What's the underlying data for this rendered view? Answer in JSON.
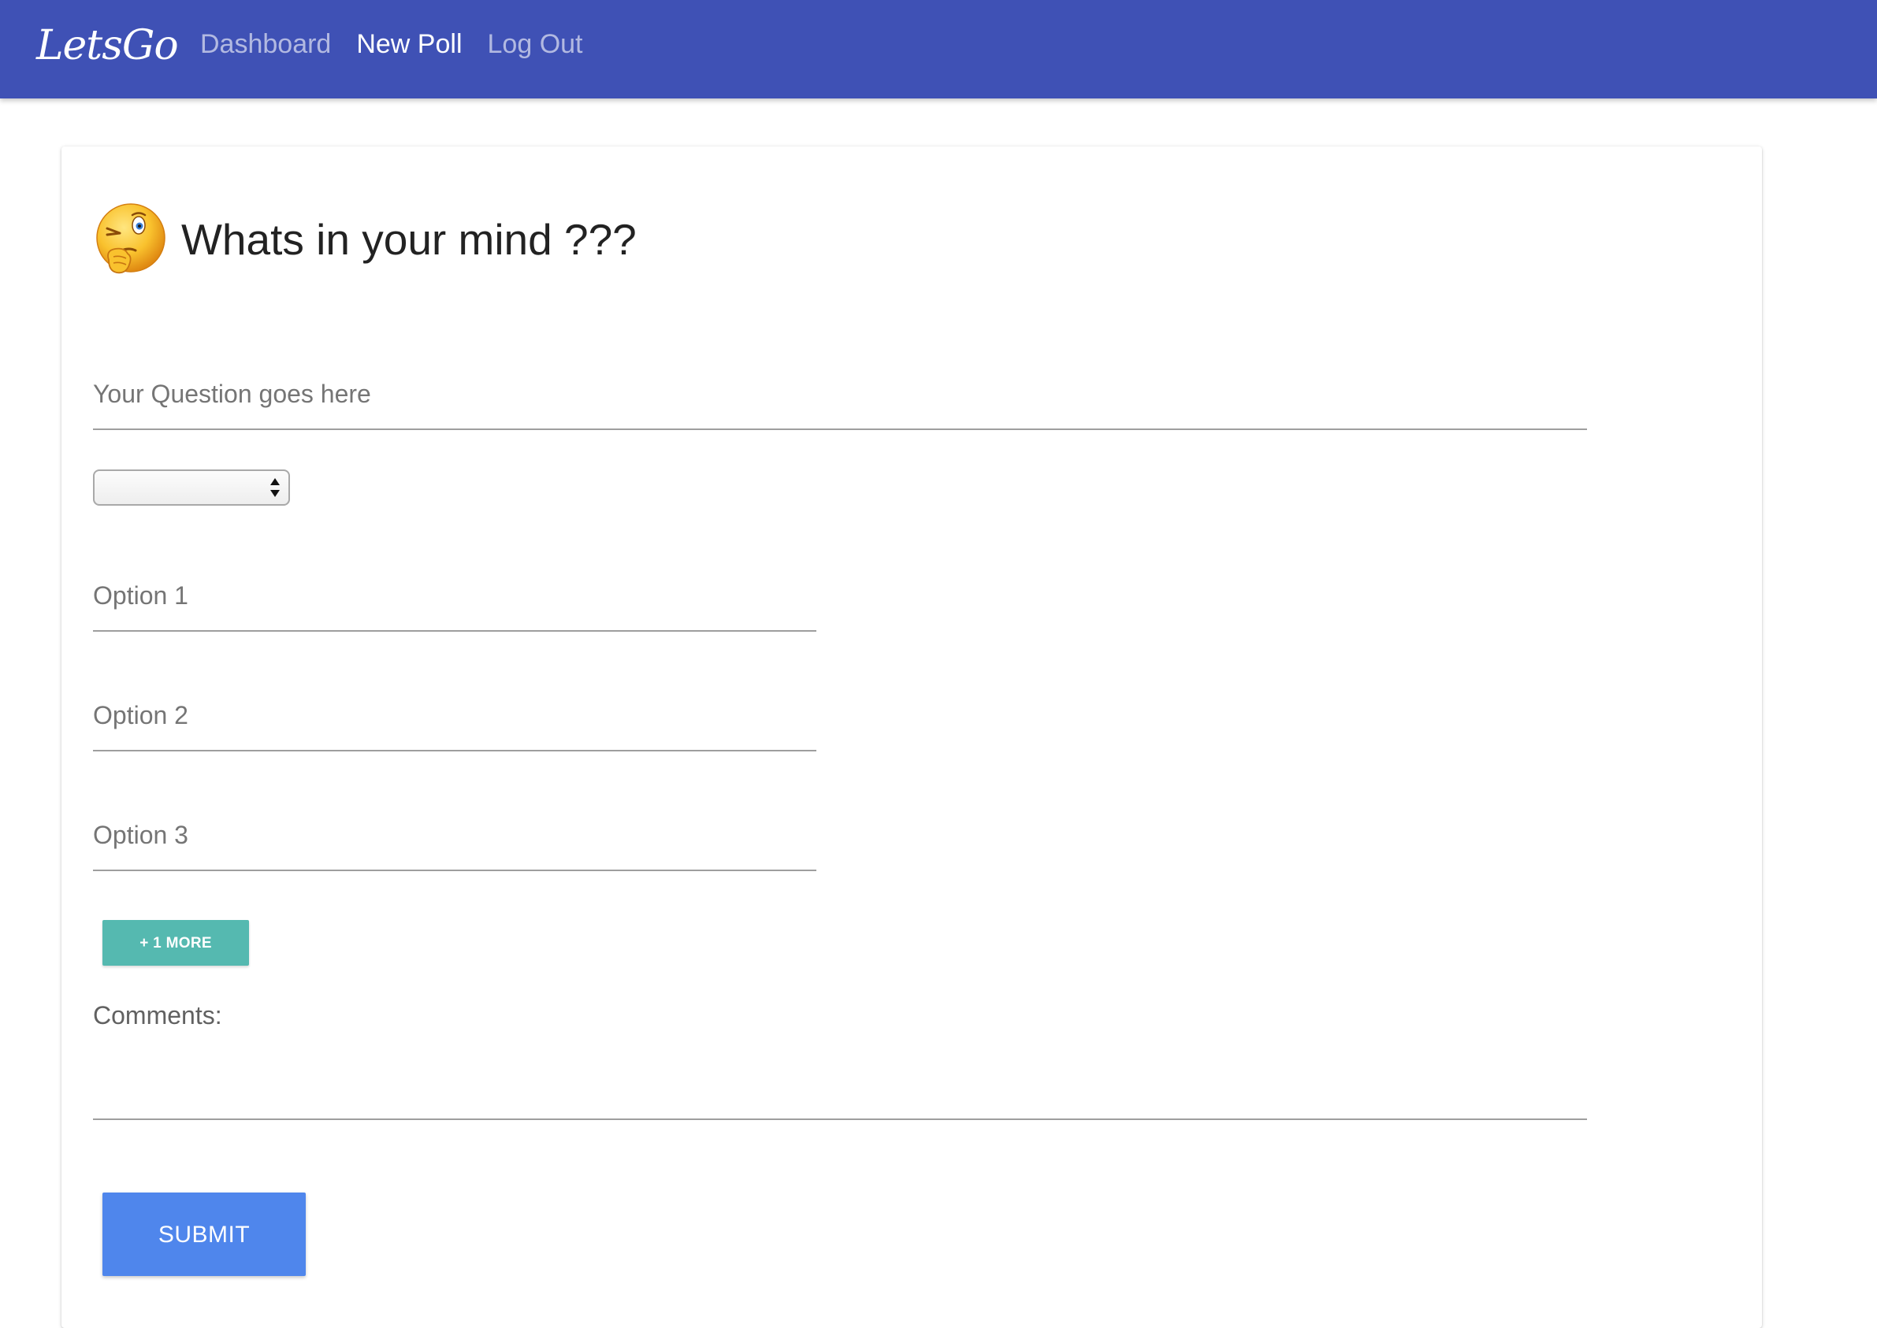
{
  "navbar": {
    "brand": "LetsGo",
    "links": [
      {
        "label": "Dashboard",
        "active": false
      },
      {
        "label": "New Poll",
        "active": true
      },
      {
        "label": "Log Out",
        "active": false
      }
    ],
    "background_color": "#3f51b5"
  },
  "form": {
    "heading": "Whats in your mind ???",
    "heading_icon": "thinking-face-icon",
    "question": {
      "placeholder": "Your Question goes here",
      "value": ""
    },
    "category_select": {
      "selected": ""
    },
    "options": [
      {
        "placeholder": "Option 1",
        "value": ""
      },
      {
        "placeholder": "Option 2",
        "value": ""
      },
      {
        "placeholder": "Option 3",
        "value": ""
      }
    ],
    "add_more_label": "+ 1 MORE",
    "comments_label": "Comments:",
    "comments_value": "",
    "submit_label": "SUBMIT",
    "colors": {
      "more_button": "#26a69a",
      "submit_button": "#4f86ec"
    }
  }
}
